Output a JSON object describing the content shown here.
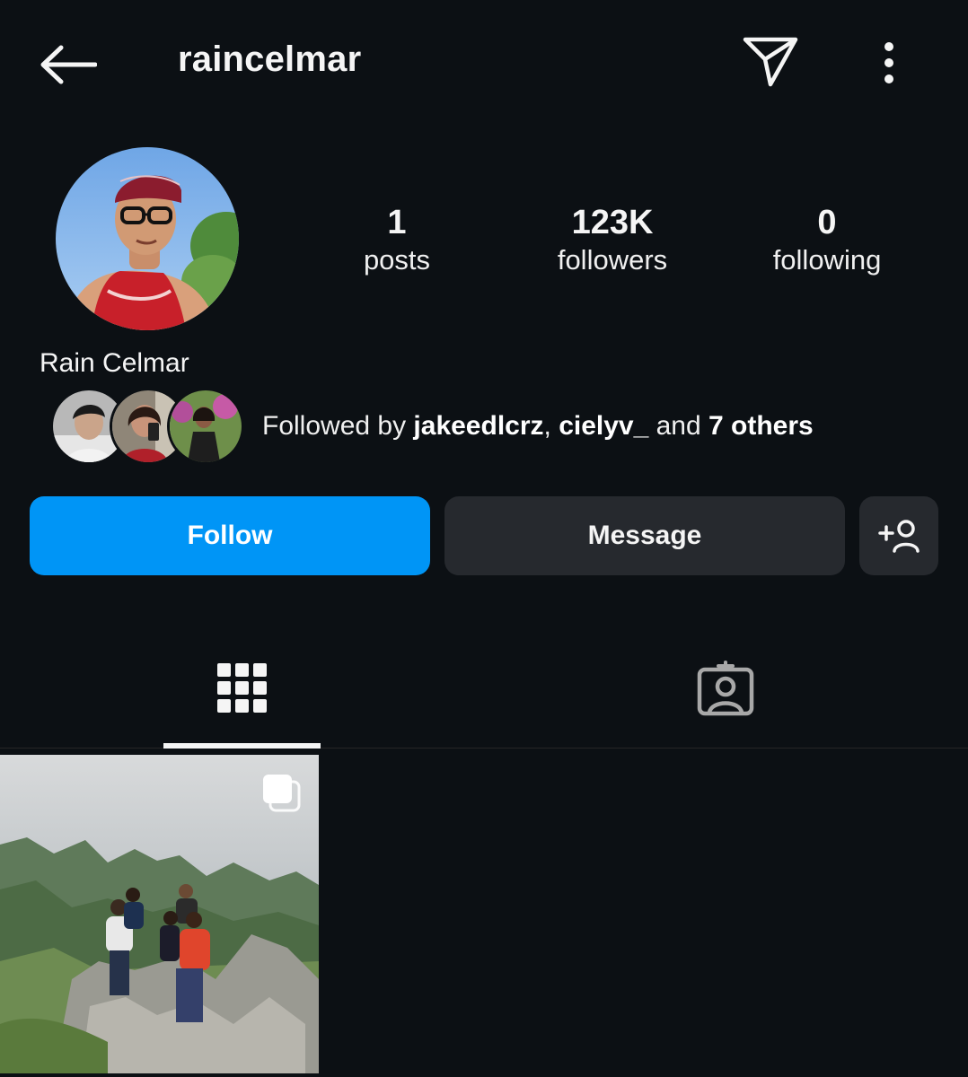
{
  "header": {
    "username": "raincelmar",
    "back_icon": "arrow-left-icon",
    "send_icon": "paper-plane-icon",
    "more_icon": "vertical-dots-icon"
  },
  "profile": {
    "display_name": "Rain Celmar",
    "avatar": "profile-photo",
    "stats": [
      {
        "value": "1",
        "label": "posts"
      },
      {
        "value": "123K",
        "label": "followers"
      },
      {
        "value": "0",
        "label": "following"
      }
    ],
    "followed_by": {
      "prefix": "Followed by ",
      "user1": "jakeedlcrz",
      "separator": ", ",
      "user2": "cielyv_",
      "mid": " and ",
      "others": "7 others"
    }
  },
  "actions": {
    "follow_label": "Follow",
    "message_label": "Message",
    "add_user_icon": "add-person-icon"
  },
  "tabs": [
    {
      "name": "posts-grid",
      "icon": "grid-icon",
      "active": true
    },
    {
      "name": "tagged",
      "icon": "tagged-person-icon",
      "active": false
    }
  ],
  "posts": [
    {
      "type": "carousel",
      "icon": "multiple-images-icon"
    }
  ],
  "colors": {
    "background": "#0c1014",
    "follow_button": "#0095f6",
    "secondary_button": "#26292e",
    "text": "#f5f5f5"
  }
}
